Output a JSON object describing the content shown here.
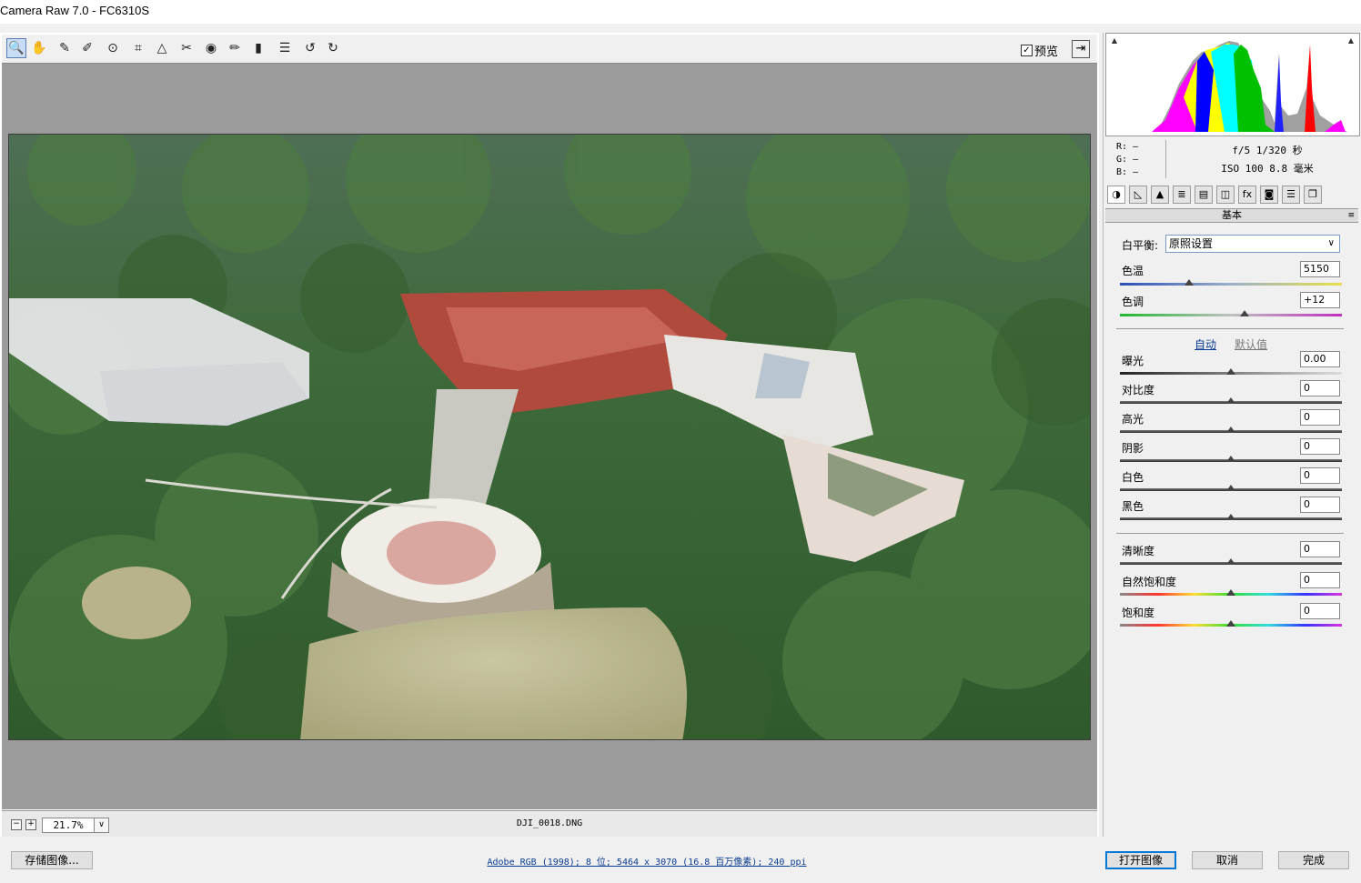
{
  "window": {
    "title": "Camera Raw 7.0 -  FC6310S"
  },
  "toolbar": {
    "tools": [
      {
        "name": "zoom-tool",
        "glyph": "🔍",
        "active": true
      },
      {
        "name": "hand-tool",
        "glyph": "✋"
      },
      {
        "name": "white-balance-tool",
        "glyph": "✎"
      },
      {
        "name": "color-sampler-tool",
        "glyph": "✐"
      },
      {
        "name": "targeted-adjustment-tool",
        "glyph": "⊙"
      },
      {
        "name": "crop-tool",
        "glyph": "⌗"
      },
      {
        "name": "straighten-tool",
        "glyph": "△"
      },
      {
        "name": "spot-removal-tool",
        "glyph": "✂"
      },
      {
        "name": "red-eye-tool",
        "glyph": "◉"
      },
      {
        "name": "adjustment-brush-tool",
        "glyph": "✏"
      },
      {
        "name": "graduated-filter-tool",
        "glyph": "▮"
      },
      {
        "name": "preferences-tool",
        "glyph": "☰"
      },
      {
        "name": "rotate-left-tool",
        "glyph": "↺"
      },
      {
        "name": "rotate-right-tool",
        "glyph": "↻"
      }
    ],
    "preview_label": "预览",
    "preview_checked": "✓",
    "fullscreen_glyph": "⇥"
  },
  "status": {
    "zoom_out": "−",
    "zoom_in": "+",
    "zoom_value": "21.7%",
    "zoom_arrow": "∨",
    "filename": "DJI_0018.DNG"
  },
  "info": {
    "r_label": "R:",
    "r_value": "—",
    "g_label": "G:",
    "g_value": "—",
    "b_label": "B:",
    "b_value": "—",
    "exif_line1": "f/5  1/320 秒",
    "exif_line2": "ISO 100  8.8 毫米"
  },
  "panel": {
    "title": "基本",
    "menu_glyph": "≡",
    "tabs": [
      "◑",
      "◺",
      "▲",
      "≣",
      "▤",
      "◫",
      "fx",
      "◙",
      "☰",
      "❐"
    ],
    "white_balance_label": "白平衡:",
    "white_balance_value": "原照设置",
    "auto_link": "自动",
    "default_link": "默认值",
    "sliders": {
      "temperature": {
        "label": "色温",
        "value": "5150",
        "pos": 0.31
      },
      "tint": {
        "label": "色调",
        "value": "+12",
        "pos": 0.56
      },
      "exposure": {
        "label": "曝光",
        "value": "0.00",
        "pos": 0.5
      },
      "contrast": {
        "label": "对比度",
        "value": "0",
        "pos": 0.5
      },
      "highlights": {
        "label": "高光",
        "value": "0",
        "pos": 0.5
      },
      "shadows": {
        "label": "阴影",
        "value": "0",
        "pos": 0.5
      },
      "whites": {
        "label": "白色",
        "value": "0",
        "pos": 0.5
      },
      "blacks": {
        "label": "黑色",
        "value": "0",
        "pos": 0.5
      },
      "clarity": {
        "label": "清晰度",
        "value": "0",
        "pos": 0.5
      },
      "vibrance": {
        "label": "自然饱和度",
        "value": "0",
        "pos": 0.5
      },
      "saturation": {
        "label": "饱和度",
        "value": "0",
        "pos": 0.5
      }
    }
  },
  "bottom": {
    "save_button": "存储图像...",
    "workflow_link": "Adobe RGB (1998); 8 位; 5464 x 3070 (16.8 百万像素); 240 ppi",
    "open_button": "打开图像",
    "cancel_button": "取消",
    "done_button": "完成"
  },
  "colors": {
    "panel_bg": "#f0f0f0",
    "canvas_bg": "#9b9b9b",
    "link": "#0b3d91",
    "primary_border": "#0078d7"
  }
}
